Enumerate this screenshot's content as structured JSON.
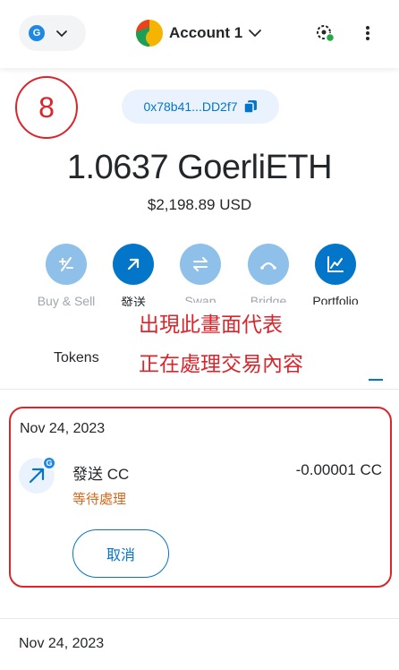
{
  "header": {
    "network_letter": "G",
    "account_name": "Account 1"
  },
  "annotation": {
    "step_number": "8",
    "note_line1": "出現此畫面代表",
    "note_line2": "正在處理交易內容"
  },
  "wallet": {
    "address": "0x78b41...DD2f7",
    "balance": "1.0637 GoerliETH",
    "fiat": "$2,198.89 USD"
  },
  "actions": [
    {
      "label": "Buy & Sell",
      "icon": "plus-minus-icon"
    },
    {
      "label": "發送",
      "icon": "send-arrow-icon"
    },
    {
      "label": "Swap",
      "icon": "swap-icon"
    },
    {
      "label": "Bridge",
      "icon": "bridge-icon"
    },
    {
      "label": "Portfolio",
      "icon": "chart-icon"
    }
  ],
  "tabs": {
    "tokens": "Tokens"
  },
  "transactions": [
    {
      "date": "Nov 24, 2023",
      "title": "發送 CC",
      "amount": "-0.00001 CC",
      "status": "等待處理",
      "cancel_label": "取消",
      "badge_letter": "G"
    },
    {
      "date": "Nov 24, 2023"
    }
  ],
  "colors": {
    "primary": "#0376c9",
    "primary_light": "#eaf3fd",
    "pending": "#d2691e",
    "annotation_red": "#d9252b"
  }
}
